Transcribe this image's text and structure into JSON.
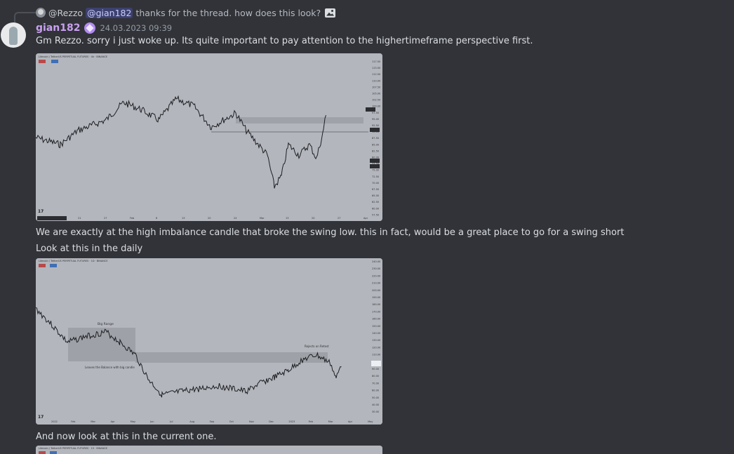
{
  "reply": {
    "author": "@Rezzo",
    "mention": "@gian182",
    "text": "thanks for the thread. how does this look?"
  },
  "message": {
    "username": "gian182",
    "timestamp": "24.03.2023 09:39",
    "line1": "Gm Rezzo. sorry i just woke up. Its quite important to pay attention to the highertimeframe perspective first.",
    "line2": "We are exactly at the high imbalance candle that broke the swing low. this in fact, would be a great place to go for a swing short",
    "line3": "Look at this in the daily",
    "line4": "And now look at this in the current one."
  },
  "chart1": {
    "title": "Litecoin / TetherUS PERPETUAL FUTURES · 4h · BINANCE",
    "xticks": [
      "21",
      "27",
      "Feb",
      "6",
      "13",
      "20",
      "24",
      "Mar",
      "13",
      "20",
      "27",
      "Apr"
    ],
    "yticks": [
      "117.50",
      "115.00",
      "112.50",
      "110.00",
      "107.50",
      "105.00",
      "102.50",
      "100.00",
      "97.50",
      "95.00",
      "92.50",
      "90.00",
      "87.50",
      "85.00",
      "82.50",
      "80.00",
      "77.50",
      "75.00",
      "72.50",
      "70.00",
      "67.50",
      "65.00",
      "62.50",
      "60.00",
      "57.50"
    ]
  },
  "chart2": {
    "title": "Litecoin / TetherUS PERPETUAL FUTURES · 1D · BINANCE",
    "annotation_big_range": "Big Range",
    "annotation_leaves": "Leaves the Balance with big candle",
    "annotation_rejects": "Rejects on Retest",
    "xticks": [
      "2022",
      "Feb",
      "Mar",
      "Apr",
      "May",
      "Jun",
      "Jul",
      "Aug",
      "Sep",
      "Oct",
      "Nov",
      "Dec",
      "2023",
      "Feb",
      "Mar",
      "Apr",
      "May"
    ],
    "yticks": [
      "240.00",
      "230.00",
      "220.00",
      "210.00",
      "200.00",
      "190.00",
      "180.00",
      "170.00",
      "160.00",
      "150.00",
      "140.00",
      "130.00",
      "120.00",
      "110.00",
      "100.00",
      "90.00",
      "80.00",
      "70.00",
      "60.00",
      "50.00",
      "40.00",
      "30.00"
    ]
  },
  "chart3": {
    "title": "Litecoin / TetherUS PERPETUAL FUTURES · 15 · BINANCE"
  },
  "colors": {
    "background": "#313338",
    "username": "#c9a0f0",
    "mention_bg": "#5865f2",
    "chart_bg": "#b3b6bd"
  }
}
